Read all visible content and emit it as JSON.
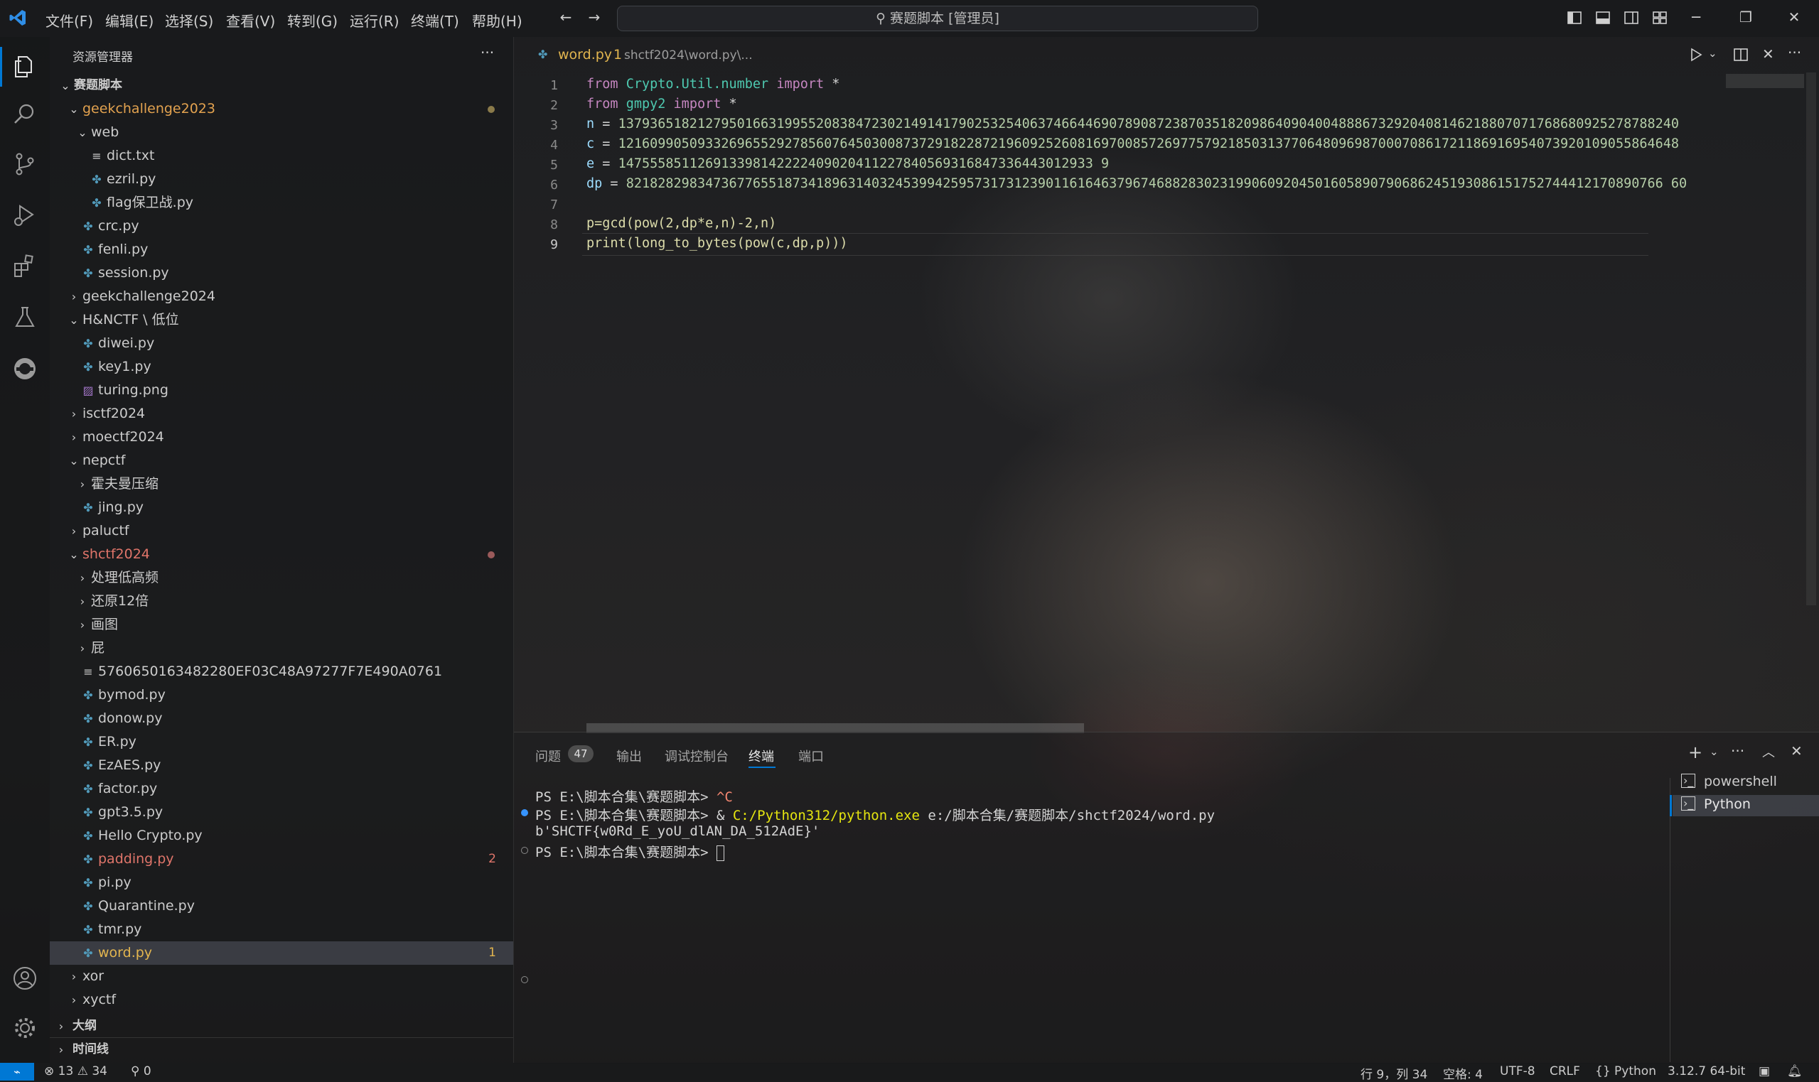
{
  "title_bar": {
    "menus": [
      "文件(F)",
      "编辑(E)",
      "选择(S)",
      "查看(V)",
      "转到(G)",
      "运行(R)",
      "终端(T)",
      "帮助(H)"
    ],
    "search_text": "赛题脚本 [管理员]"
  },
  "sidebar": {
    "header": "资源管理器",
    "more": "···",
    "items": [
      {
        "label": "赛题脚本",
        "depth": 0,
        "kind": "folder-open",
        "bold": true
      },
      {
        "label": "geekchallenge2023",
        "depth": 1,
        "kind": "folder-open",
        "color": "#e2a24f",
        "dot": "#8a7a4a"
      },
      {
        "label": "web",
        "depth": 2,
        "kind": "folder-open"
      },
      {
        "label": "dict.txt",
        "depth": 3,
        "kind": "txt"
      },
      {
        "label": "ezril.py",
        "depth": 3,
        "kind": "py"
      },
      {
        "label": "flag保卫战.py",
        "depth": 3,
        "kind": "py"
      },
      {
        "label": "crc.py",
        "depth": 2,
        "kind": "py"
      },
      {
        "label": "fenli.py",
        "depth": 2,
        "kind": "py"
      },
      {
        "label": "session.py",
        "depth": 2,
        "kind": "py"
      },
      {
        "label": "geekchallenge2024",
        "depth": 1,
        "kind": "folder"
      },
      {
        "label": "H&NCTF \\ 低位",
        "depth": 1,
        "kind": "folder-open"
      },
      {
        "label": "diwei.py",
        "depth": 2,
        "kind": "py"
      },
      {
        "label": "key1.py",
        "depth": 2,
        "kind": "py"
      },
      {
        "label": "turing.png",
        "depth": 2,
        "kind": "img"
      },
      {
        "label": "isctf2024",
        "depth": 1,
        "kind": "folder"
      },
      {
        "label": "moectf2024",
        "depth": 1,
        "kind": "folder"
      },
      {
        "label": "nepctf",
        "depth": 1,
        "kind": "folder-open"
      },
      {
        "label": "霍夫曼压缩",
        "depth": 2,
        "kind": "folder"
      },
      {
        "label": "jing.py",
        "depth": 2,
        "kind": "py"
      },
      {
        "label": "paluctf",
        "depth": 1,
        "kind": "folder"
      },
      {
        "label": "shctf2024",
        "depth": 1,
        "kind": "folder-open",
        "color": "#e0756a",
        "dot": "#9a5a5a"
      },
      {
        "label": "处理低高频",
        "depth": 2,
        "kind": "folder"
      },
      {
        "label": "还原12倍",
        "depth": 2,
        "kind": "folder"
      },
      {
        "label": "画图",
        "depth": 2,
        "kind": "folder"
      },
      {
        "label": "屁",
        "depth": 2,
        "kind": "folder"
      },
      {
        "label": "5760650163482280EF03C48A97277F7E490A0761",
        "depth": 2,
        "kind": "txt"
      },
      {
        "label": "bymod.py",
        "depth": 2,
        "kind": "py"
      },
      {
        "label": "donow.py",
        "depth": 2,
        "kind": "py"
      },
      {
        "label": "ER.py",
        "depth": 2,
        "kind": "py"
      },
      {
        "label": "EzAES.py",
        "depth": 2,
        "kind": "py"
      },
      {
        "label": "factor.py",
        "depth": 2,
        "kind": "py"
      },
      {
        "label": "gpt3.5.py",
        "depth": 2,
        "kind": "py"
      },
      {
        "label": "Hello Crypto.py",
        "depth": 2,
        "kind": "py"
      },
      {
        "label": "padding.py",
        "depth": 2,
        "kind": "py",
        "color": "#e0756a",
        "badge": "2",
        "badge_color": "#e0756a"
      },
      {
        "label": "pi.py",
        "depth": 2,
        "kind": "py"
      },
      {
        "label": "Quarantine.py",
        "depth": 2,
        "kind": "py"
      },
      {
        "label": "tmr.py",
        "depth": 2,
        "kind": "py"
      },
      {
        "label": "word.py",
        "depth": 2,
        "kind": "py",
        "color": "#e2b54f",
        "badge": "1",
        "badge_color": "#e2b54f",
        "selected": true
      },
      {
        "label": "xor",
        "depth": 1,
        "kind": "folder"
      },
      {
        "label": "xyctf",
        "depth": 1,
        "kind": "folder"
      }
    ],
    "outline": "大纲",
    "timeline": "时间线"
  },
  "editor": {
    "tab_name": "word.py",
    "tab_badge": "1",
    "tab_path": "shctf2024\\word.py\\...",
    "line_numbers": [
      "1",
      "2",
      "3",
      "4",
      "5",
      "6",
      "7",
      "8",
      "9"
    ],
    "code": {
      "l1_from": "from",
      "l1_mod": "Crypto.Util.number",
      "l1_import": "import",
      "l1_star": "*",
      "l2_from": "from",
      "l2_mod": "gmpy2",
      "l2_import": "import",
      "l2_star": "*",
      "l3_var": "n",
      "l3_val": "13793651821279501663199552083847230214914179025325406374664469078908723870351820986409040048886732920408146218807071768680925278788240",
      "l4_var": "c",
      "l4_val": "12160990509332696552927856076450300873729182287219609252608169700857269775792185031377064809698700070861721186916954073920109055864648",
      "l5_var": "e",
      "l5_val": "147555851126913398142222409020411227840569316847336443012933 9",
      "l6_var": "dp",
      "l6_val": "82182829834736776551873418963140324539942595731731239011616463796746882830231990609204501605890790686245193086151752744412170890766 60",
      "l8": "p=gcd(pow(2,dp*e,n)-2,n)",
      "l9": "print(long_to_bytes(pow(c,dp,p)))"
    }
  },
  "panel": {
    "tabs": [
      "问题",
      "输出",
      "调试控制台",
      "终端",
      "端口"
    ],
    "problems_count": "47",
    "active_tab": "终端",
    "terminal_lines": {
      "t1_prompt": "PS E:\\脚本合集\\赛题脚本> ",
      "t1_cmd": "^C",
      "t2_prompt": "PS E:\\脚本合集\\赛题脚本> ",
      "t2_amp": "& ",
      "t2_exe": "C:/Python312/python.exe",
      "t2_arg": " e:/脚本合集/赛题脚本/shctf2024/word.py",
      "t3": "b'SHCTF{w0Rd_E_yoU_dlAN_DA_512AdE}'",
      "t4_prompt": "PS E:\\脚本合集\\赛题脚本> "
    },
    "terminals": [
      "powershell",
      "Python"
    ]
  },
  "status_bar": {
    "errors": "13",
    "warnings": "34",
    "ports": "0",
    "cursor": "行 9，列 34",
    "spaces": "空格: 4",
    "encoding": "UTF-8",
    "eol": "CRLF",
    "language": "Python",
    "interpreter": "3.12.7 64-bit"
  },
  "colors": {
    "accent": "#0078d4",
    "keyword": "#c586c0",
    "variable": "#9cdcfe",
    "function": "#dcdcaa",
    "number": "#b5cea8",
    "python_file": "#519aba"
  }
}
